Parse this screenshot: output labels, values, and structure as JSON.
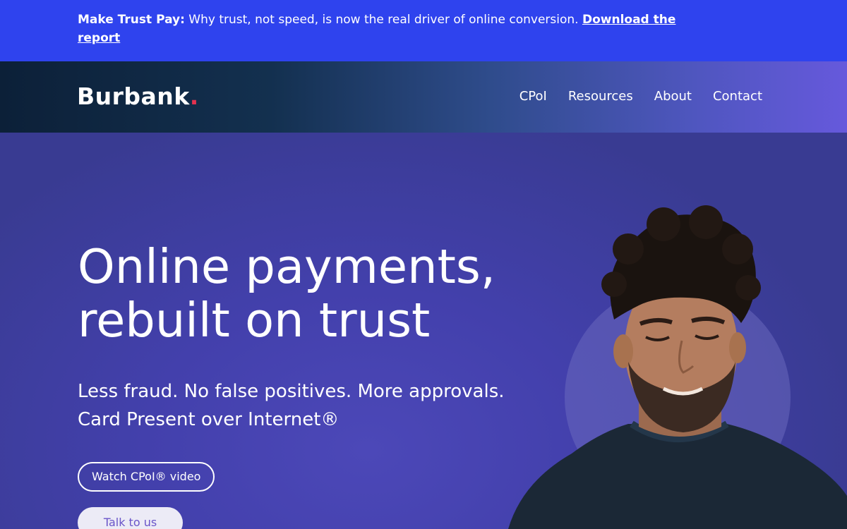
{
  "announcement": {
    "lead": "Make Trust Pay:",
    "text": " Why trust, not speed, is now the real driver of online conversion. ",
    "link": "Download the report"
  },
  "header": {
    "logo_text": "Burbank",
    "logo_dot": ".",
    "nav": [
      {
        "label": "CPoI"
      },
      {
        "label": "Resources"
      },
      {
        "label": "About"
      },
      {
        "label": "Contact"
      }
    ]
  },
  "hero": {
    "title_line1": "Online payments,",
    "title_line2": "rebuilt on trust",
    "subtitle_line1": "Less fraud. No false positives. More approvals.",
    "subtitle_line2": "Card Present over Internet®",
    "video_button": "Watch CPoI® video",
    "talk_button": "Talk to us"
  },
  "colors": {
    "announce_bg": "#2f43ee",
    "hero_bg": "#4340ac",
    "logo_dot": "#e2324f",
    "talk_button_text": "#6a55c9"
  }
}
